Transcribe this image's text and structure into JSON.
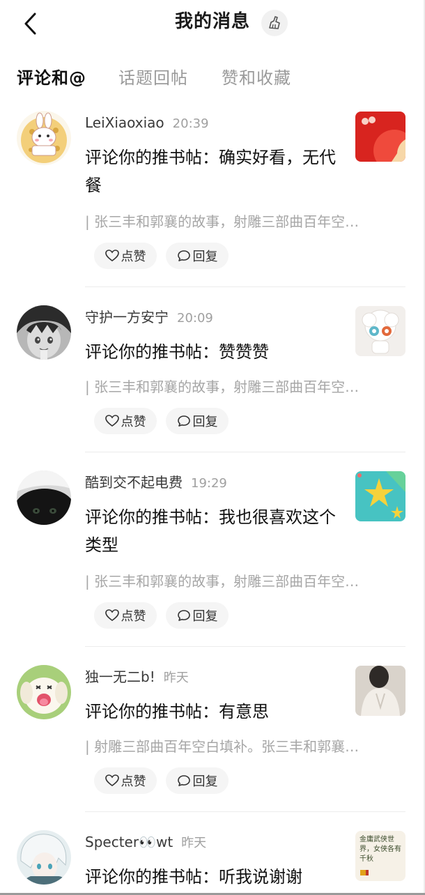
{
  "header": {
    "title": "我的消息",
    "back_icon": "chevron-left-icon",
    "clear_icon": "broom-icon"
  },
  "tabs": [
    {
      "label": "评论和@",
      "active": true
    },
    {
      "label": "话题回帖",
      "active": false
    },
    {
      "label": "赞和收藏",
      "active": false
    }
  ],
  "actions": {
    "like_label": "点赞",
    "reply_label": "回复"
  },
  "messages": [
    {
      "username": "LeiXiaoxiao",
      "time": "20:39",
      "comment": "评论你的推书帖：确实好看，无代餐",
      "quote": "| 张三丰和郭襄的故事，射雕三部曲百年空…",
      "avatar": "bunny-cookie-avatar",
      "thumbnail": "red-cover-thumbnail"
    },
    {
      "username": "守护一方安宁",
      "time": "20:09",
      "comment": "评论你的推书帖：赞赞赞",
      "quote": "| 张三丰和郭襄的故事，射雕三部曲百年空…",
      "avatar": "dark-hair-boy-avatar",
      "thumbnail": "white-doll-thumbnail"
    },
    {
      "username": "酷到交不起电费",
      "time": "19:29",
      "comment": "评论你的推书帖：我也很喜欢这个类型",
      "quote": "| 张三丰和郭襄的故事，射雕三部曲百年空…",
      "avatar": "black-cat-avatar",
      "thumbnail": "star-teal-thumbnail"
    },
    {
      "username": "独一无二b!",
      "time": "昨天",
      "comment": "评论你的推书帖：有意思",
      "quote": "| 射雕三部曲百年空白填补。张三丰和郭襄…",
      "avatar": "white-puppy-avatar",
      "thumbnail": "photo-thumbnail"
    },
    {
      "username": "Specter👀wt",
      "time": "昨天",
      "comment": "评论你的推书帖：听我说谢谢",
      "quote": "",
      "avatar": "white-hair-anime-avatar",
      "thumbnail": "text-card-thumbnail",
      "thumbnail_text": "金庸武侠世界，女侠各有千秋"
    }
  ],
  "colors": {
    "accent_red": "#e53935",
    "text_primary": "#111111",
    "text_secondary": "#a6a6a6",
    "button_bg": "#f5f5f5"
  }
}
